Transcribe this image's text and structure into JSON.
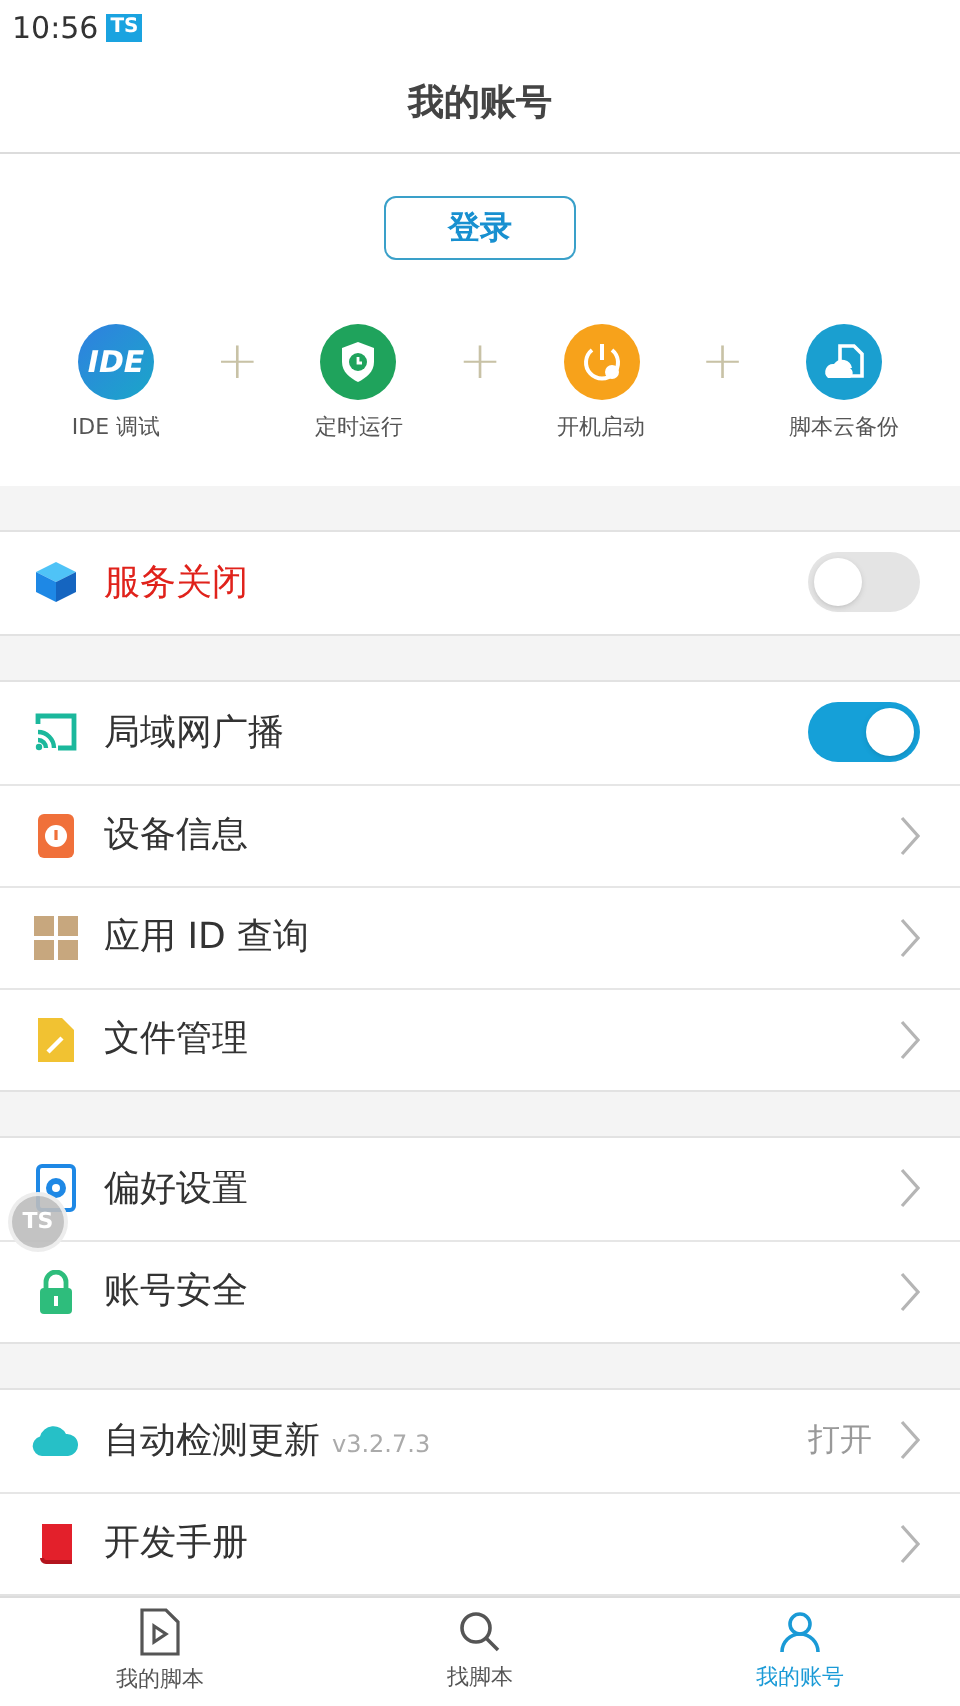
{
  "status_bar": {
    "time": "10:56",
    "app_badge": "TS"
  },
  "title": "我的账号",
  "login_button": "登录",
  "features": [
    {
      "kind": "ide",
      "icon_text": "IDE",
      "label": "IDE 调试"
    },
    {
      "kind": "timer",
      "label": "定时运行"
    },
    {
      "kind": "power",
      "label": "开机启动"
    },
    {
      "kind": "cloud-file",
      "label": "脚本云备份"
    }
  ],
  "feature_separator": "+",
  "sections": [
    {
      "rows": [
        {
          "kind": "toggle",
          "label": "服务关闭",
          "alert": true,
          "on": false
        }
      ]
    },
    {
      "rows": [
        {
          "kind": "toggle",
          "label": "局域网广播",
          "alert": false,
          "on": true
        },
        {
          "kind": "link",
          "label": "设备信息",
          "alert": false
        },
        {
          "kind": "link",
          "label": "应用 ID 查询",
          "alert": false
        },
        {
          "kind": "link",
          "label": "文件管理",
          "alert": false
        }
      ]
    },
    {
      "rows": [
        {
          "kind": "link",
          "label": "偏好设置",
          "alert": false
        },
        {
          "kind": "link",
          "label": "账号安全",
          "alert": false
        }
      ]
    },
    {
      "rows": [
        {
          "kind": "link",
          "label": "自动检测更新",
          "version": "v3.2.7.3",
          "value": "打开",
          "alert": false
        },
        {
          "kind": "link",
          "label": "开发手册",
          "alert": false
        }
      ]
    }
  ],
  "floating_badge": "TS",
  "tabs": [
    {
      "kind": "script",
      "label": "我的脚本",
      "selected": false
    },
    {
      "kind": "search",
      "label": "找脚本",
      "selected": false
    },
    {
      "kind": "user",
      "label": "我的账号",
      "selected": true
    }
  ]
}
